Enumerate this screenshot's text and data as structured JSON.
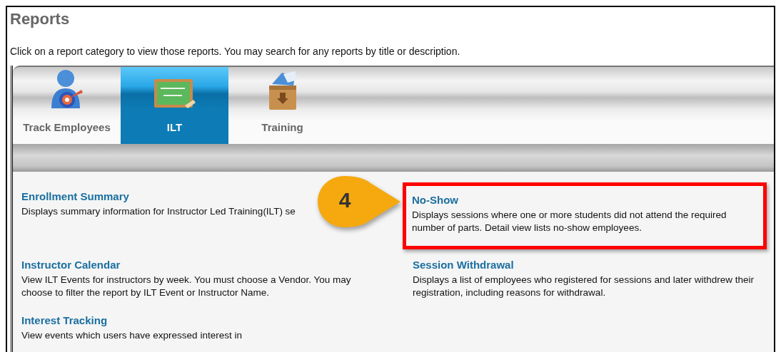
{
  "page": {
    "title": "Reports",
    "intro": "Click on a report category to view those reports. You may search for any reports by title or description."
  },
  "tabs": [
    {
      "label": "Track Employees",
      "kind": "person",
      "selected": false
    },
    {
      "label": "ILT",
      "kind": "chalkboard",
      "selected": true
    },
    {
      "label": "Training",
      "kind": "crate",
      "selected": false
    }
  ],
  "reports": [
    {
      "title": "Enrollment Summary",
      "description": "Displays summary information for Instructor Led Training(ILT) se",
      "highlighted": false
    },
    {
      "title": "No-Show",
      "description": "Displays sessions where one or more students did not attend the required number of parts. Detail view lists no-show employees.",
      "highlighted": true
    },
    {
      "title": "Instructor Calendar",
      "description": "View ILT Events for instructors by week. You must choose a Vendor. You may choose to filter the report by ILT Event or Instructor Name.",
      "highlighted": false
    },
    {
      "title": "Session Withdrawal",
      "description": "Displays a list of employees who registered for sessions and later withdrew their registration, including reasons for withdrawal.",
      "highlighted": false
    },
    {
      "title": "Interest Tracking",
      "description": "View events which users have expressed interest in",
      "highlighted": false
    }
  ],
  "callout": {
    "label": "4"
  }
}
